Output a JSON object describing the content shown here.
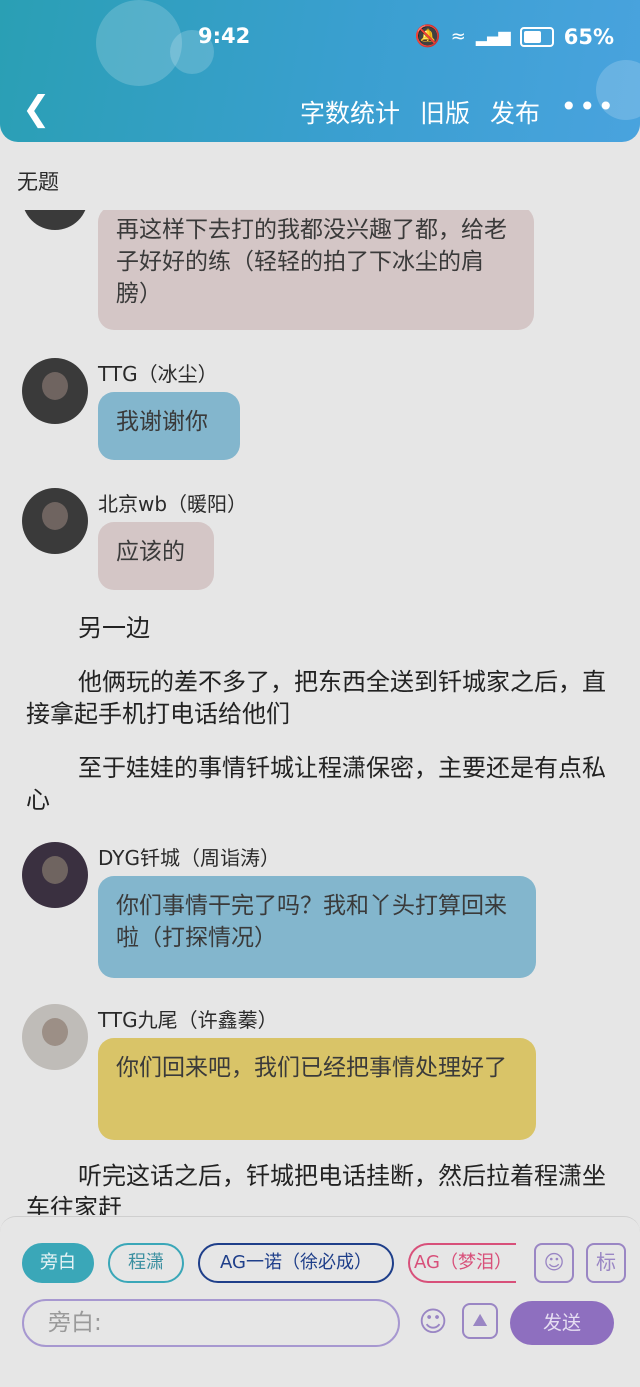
{
  "status": {
    "time": "9:42",
    "battery": "65%"
  },
  "nav": {
    "actions": [
      "字数统计",
      "旧版",
      "发布"
    ],
    "back_icon": "back-chevron-icon",
    "more_icon": "more-dots-icon"
  },
  "doc_title": "无题",
  "messages": [
    {
      "text": "再这样下去打的我都没兴趣了都，给老子好好的练（轻轻的拍了下冰尘的肩膀）"
    },
    {
      "name": "TTG（冰尘）",
      "text": "我谢谢你"
    },
    {
      "name": "北京wb（暖阳）",
      "text": "应该的"
    },
    {
      "name": "DYG钎城（周诣涛）",
      "text": "你们事情干完了吗？我和丫头打算回来啦（打探情况）"
    },
    {
      "name": "TTG九尾（许鑫蓁）",
      "text": "你们回来吧，我们已经把事情处理好了"
    }
  ],
  "narrations": [
    "另一边",
    "他俩玩的差不多了，把东西全送到钎城家之后，直接拿起手机打电话给他们",
    "至于娃娃的事情钎城让程潇保密，主要还是有点私心",
    "听完这话之后，钎城把电话挂断，然后拉着程潇坐车往家赶"
  ],
  "chips": [
    "旁白",
    "程潇",
    "AG一诺（徐必成）",
    "AG（梦泪）"
  ],
  "chip_colors": [
    "#3aa7b8",
    "#3aa7b8",
    "#1f3f8a",
    "#d8507a"
  ],
  "tag_button": "标",
  "input": {
    "placeholder": "旁白:"
  },
  "send_label": "发送"
}
